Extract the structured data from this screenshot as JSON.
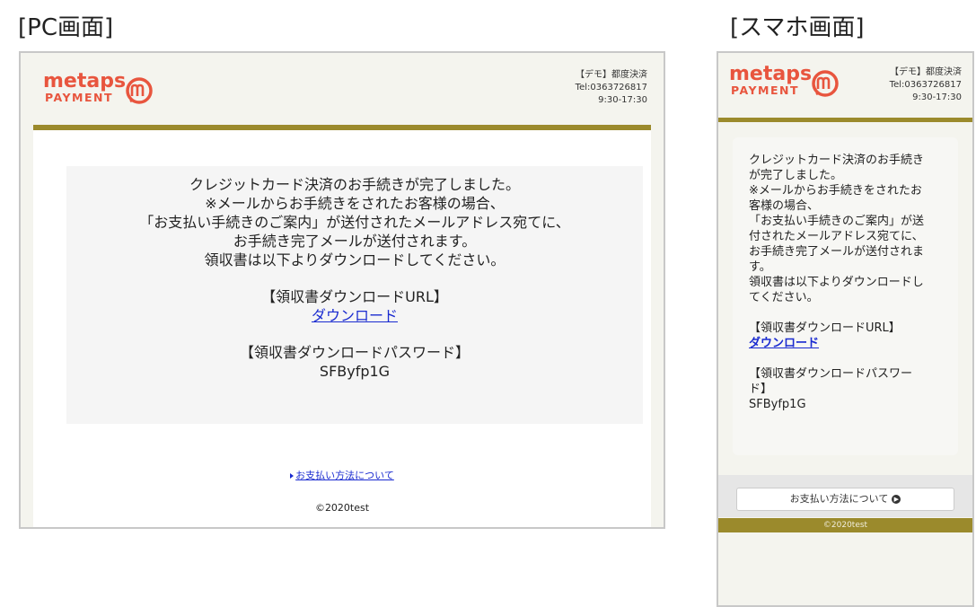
{
  "captions": {
    "pc": "[PC画面]",
    "sp": "[スマホ画面]"
  },
  "brand": {
    "name_top": "metaps",
    "name_bottom": "PAYMENT",
    "accent_color": "#e8553e",
    "band_color": "#9b8a2c"
  },
  "contact": {
    "line1": "【デモ】都度決済",
    "line2": "Tel:0363726817",
    "line3": "9:30-17:30"
  },
  "message": {
    "pc_lines": [
      "クレジットカード決済のお手続きが完了しました。",
      "※メールからお手続きをされたお客様の場合、",
      "「お支払い手続きのご案内」が送付されたメールアドレス宛てに、",
      "お手続き完了メールが送付されます。",
      "領収書は以下よりダウンロードしてください。"
    ],
    "sp_lines": [
      "クレジットカード決済のお手続き",
      "が完了しました。",
      "※メールからお手続きをされたお",
      "客様の場合、",
      "「お支払い手続きのご案内」が送",
      "付されたメールアドレス宛てに、",
      "お手続き完了メールが送付されま",
      "す。",
      "領収書は以下よりダウンロードし",
      "てください。"
    ]
  },
  "receipt": {
    "url_heading": "【領収書ダウンロードURL】",
    "download_link": "ダウンロード",
    "password_heading": "【領収書ダウンロードパスワード】",
    "password_heading_sp_line1": "【領収書ダウンロードパスワー",
    "password_heading_sp_line2": "ド】",
    "password": "SFByfp1G"
  },
  "footer": {
    "payment_link": "お支払い方法について",
    "copyright": "©2020test"
  }
}
